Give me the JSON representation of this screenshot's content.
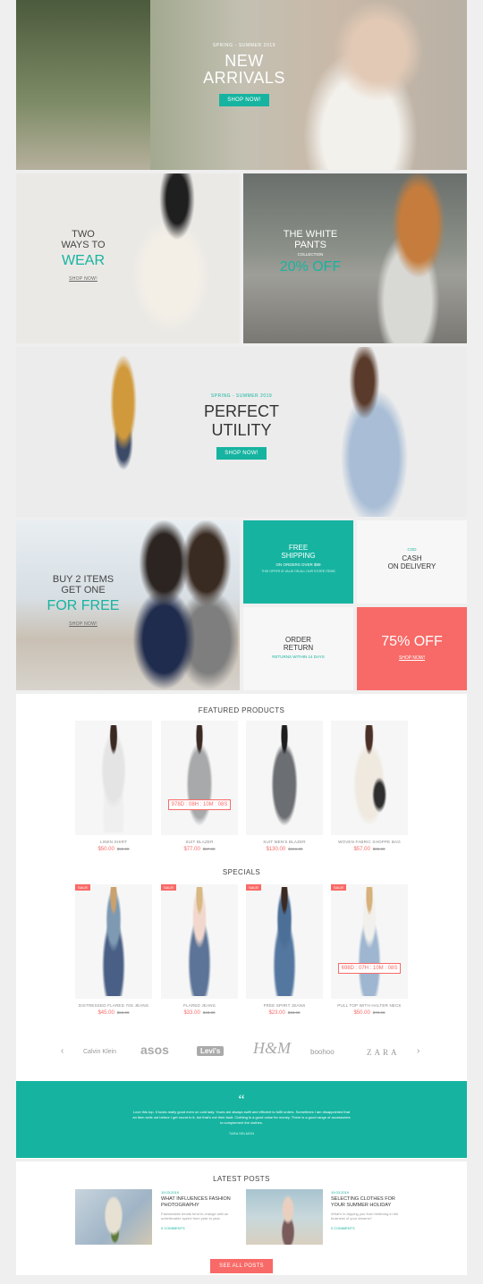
{
  "hero": {
    "kicker": "SPRING - SUMMER 2019",
    "title_line1": "NEW",
    "title_line2": "ARRIVALS",
    "button": "SHOP NOW!"
  },
  "banner_wear": {
    "line1": "TWO",
    "line2": "WAYS TO",
    "accent": "WEAR",
    "link": "SHOP NOW!"
  },
  "banner_pants": {
    "line1": "THE WHITE",
    "line2": "PANTS",
    "sub": "COLLECTION",
    "accent": "20% OFF"
  },
  "banner_utility": {
    "kicker": "SPRING - SUMMER 2019",
    "line1": "PERFECT",
    "line2": "UTILITY",
    "button": "SHOP NOW!"
  },
  "banner_buy2": {
    "line1": "BUY 2 ITEMS",
    "line2": "GET ONE",
    "accent": "FOR FREE",
    "link": "SHOP NOW!"
  },
  "free_shipping": {
    "line1": "FREE",
    "line2": "SHIPPING",
    "sub": "ON ORDERS OVER $99",
    "note": "THIS OFFER IS VALID ON ALL OUR STORE ITEMS"
  },
  "cod": {
    "kicker": "COD",
    "line1": "CASH",
    "line2": "ON DELIVERY"
  },
  "order_return": {
    "line1": "ORDER",
    "line2": "RETURN",
    "sub": "RETURNS WITHIN 14 DAYS"
  },
  "sale75": {
    "title": "75% OFF",
    "link": "SHOP NOW!"
  },
  "featured": {
    "title": "FEATURED PRODUCTS",
    "items": [
      {
        "name": "LINEN SHIRT",
        "price": "$50.00",
        "old": "$59.00"
      },
      {
        "name": "SUIT BLAZER",
        "price": "$77.00",
        "old": "$87.00",
        "timer": "978D : 08H : 10M : 08S"
      },
      {
        "name": "SUIT MEN'S BLAZER",
        "price": "$130.00",
        "old": "$151.00"
      },
      {
        "name": "WOVEN FABRIC SHOPPE BAG",
        "price": "$57.00",
        "old": "$85.00"
      }
    ]
  },
  "specials": {
    "title": "SPECIALS",
    "sale_badge": "SALE!",
    "items": [
      {
        "name": "DISTRESSED FLARED 70S JEANS",
        "price": "$45.00",
        "old": "$55.00"
      },
      {
        "name": "FLARED JEANS",
        "price": "$33.00",
        "old": "$43.00"
      },
      {
        "name": "FREE SPIRIT JEANS",
        "price": "$23.00",
        "old": "$33.00"
      },
      {
        "name": "PULL TOP WITH HALTER NECK",
        "price": "$50.00",
        "old": "$79.00",
        "timer": "698D : 07H : 10M : 08S"
      }
    ]
  },
  "brands": {
    "prev": "‹",
    "next": "›",
    "names": [
      "Calvin Klein",
      "asos",
      "Levi's",
      "H&M",
      "boohoo",
      "ZARA"
    ]
  },
  "testimonial": {
    "quote_mark": "“",
    "text": "Love this top. It looks really good even on cold lady. Yours are always swift and efficient to fulfil orders. Sometimes I am disappointed that an item sells out before I get round to it, but that's not their fault. Clothing is a good value for money. There is a good range of accessories to complement the clothes.",
    "author": "TARA SELMON"
  },
  "posts": {
    "title": "LATEST POSTS",
    "items": [
      {
        "date": "19.03.2019",
        "title": "WHAT INFLUENCES FASHION PHOTOGRAPHY",
        "excerpt": "Fashionable trends tend to change with an unbelievable speed from year to year.",
        "comments": "0 COMMENTS"
      },
      {
        "date": "19.03.2019",
        "title": "SELECTING CLOTHES FOR YOUR SUMMER HOLIDAY",
        "excerpt": "What's in-tripping you from believing in the business of your dreams?",
        "comments": "0 COMMENTS"
      }
    ],
    "button": "SEE ALL POSTS"
  },
  "colors": {
    "accent": "#16b4a0",
    "sale": "#f86a67",
    "background": "#efefef"
  }
}
